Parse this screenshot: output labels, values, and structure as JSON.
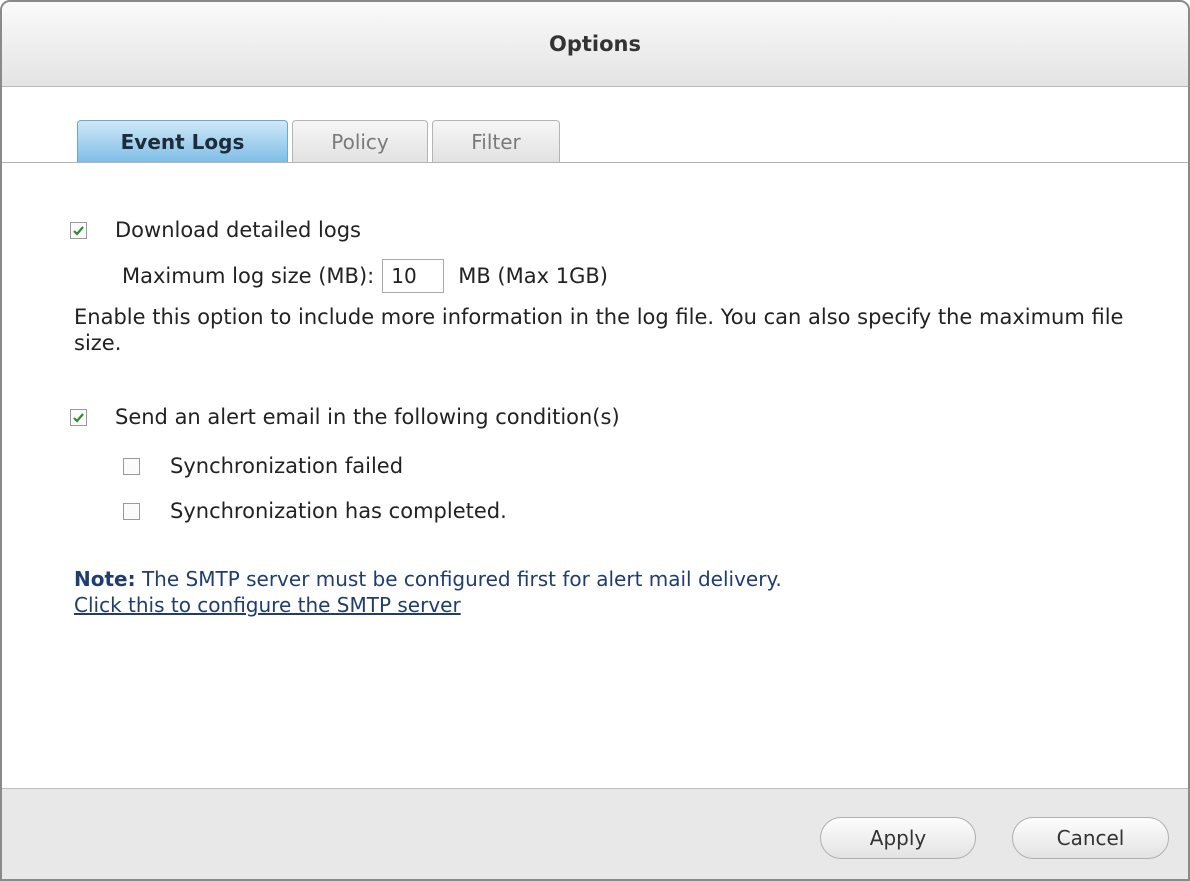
{
  "dialog": {
    "title": "Options"
  },
  "tabs": [
    {
      "label": "Event Logs",
      "active": true
    },
    {
      "label": "Policy",
      "active": false
    },
    {
      "label": "Filter",
      "active": false
    }
  ],
  "event_logs": {
    "download_detailed_logs": {
      "label": "Download detailed logs",
      "checked": true
    },
    "max_log_size": {
      "label": "Maximum log size (MB):",
      "value": "10",
      "suffix": "MB (Max 1GB)"
    },
    "description": "Enable this option to include more information in the log file. You can also specify the maximum file size.",
    "send_alert": {
      "label": "Send an alert email in the following condition(s)",
      "checked": true
    },
    "conditions": [
      {
        "label": "Synchronization failed",
        "checked": false
      },
      {
        "label": "Synchronization has completed.",
        "checked": false
      }
    ],
    "note_label": "Note:",
    "note_text": " The SMTP server must be configured first for alert mail delivery.",
    "smtp_link": "Click this to configure the SMTP server"
  },
  "footer": {
    "apply_label": "Apply",
    "cancel_label": "Cancel"
  },
  "colors": {
    "accent": "#7fbde6",
    "check": "#2e8b2e",
    "link": "#1f3d6e"
  }
}
